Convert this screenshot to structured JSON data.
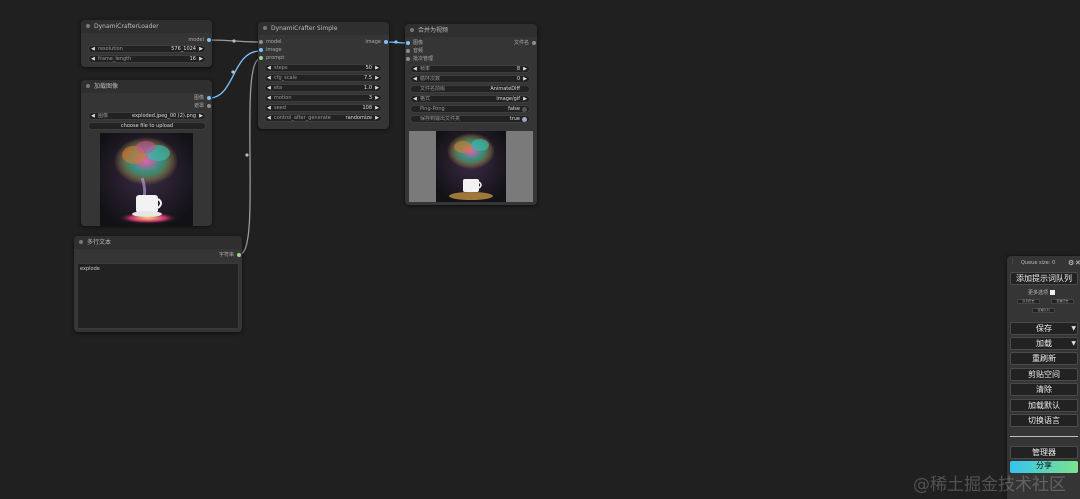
{
  "nodes": {
    "loader": {
      "title": "DynamiCrafterLoader",
      "output": "model",
      "widgets": [
        {
          "label": "resolution",
          "value": "576_1024"
        },
        {
          "label": "frame_length",
          "value": "16"
        }
      ]
    },
    "simple": {
      "title": "DynamiCrafter Simple",
      "inputs": [
        "model",
        "image",
        "prompt"
      ],
      "output": "image",
      "widgets": [
        {
          "label": "steps",
          "value": "50"
        },
        {
          "label": "cfg_scale",
          "value": "7.5"
        },
        {
          "label": "eta",
          "value": "1.0"
        },
        {
          "label": "motion",
          "value": "3"
        },
        {
          "label": "seed",
          "value": "108"
        },
        {
          "label": "control_after_generate",
          "value": "randomize"
        }
      ]
    },
    "load_image": {
      "title": "加载图像",
      "outputs": [
        "图像",
        "遮罩"
      ],
      "widget": {
        "label": "图像",
        "value": "exploded.jpeg_00 (2).png"
      },
      "upload_label": "choose file to upload"
    },
    "combine": {
      "title": "合并为视频",
      "inputs": [
        "图像",
        "音频",
        "批次管理"
      ],
      "output": "文件名",
      "widgets": [
        {
          "label": "帧率",
          "value": "8"
        },
        {
          "label": "循环次数",
          "value": "0"
        },
        {
          "label": "文件名前缀",
          "value": "AnimateDiff"
        },
        {
          "label": "格式",
          "value": "image/gif"
        },
        {
          "label": "Ping-Pong",
          "value": "false"
        },
        {
          "label": "保存到输出文件夹",
          "value": "true"
        }
      ]
    },
    "text": {
      "title": "多行文本",
      "output": "字符串",
      "value": "explode"
    }
  },
  "side_panel": {
    "queue_size": "Queue size: 0",
    "queue_prompt": "添加提示词队列",
    "more_options": "更多选项",
    "tiny_buttons": [
      "队列历史",
      "查看历史",
      "查看队列"
    ],
    "buttons": [
      {
        "label": "保存",
        "has_dropdown": true
      },
      {
        "label": "加载",
        "has_dropdown": true
      },
      {
        "label": "重刷新",
        "has_dropdown": false
      },
      {
        "label": "剪贴空间",
        "has_dropdown": false
      },
      {
        "label": "清除",
        "has_dropdown": false
      },
      {
        "label": "加载默认",
        "has_dropdown": false
      },
      {
        "label": "切换语言",
        "has_dropdown": false
      }
    ],
    "manager": "管理器",
    "share": "分享"
  },
  "watermark": "@稀土掘金技术社区",
  "colors": {
    "background": "#202020",
    "node": "#353535",
    "link_blue": "#7ec3ff",
    "link_gray": "#9a9a9a",
    "share_gradient_start": "#33c3f0",
    "share_gradient_end": "#7de38d"
  },
  "icons": [
    "arrow-left-icon",
    "arrow-right-icon",
    "gear-icon",
    "close-icon",
    "dropdown-arrow-icon"
  ]
}
